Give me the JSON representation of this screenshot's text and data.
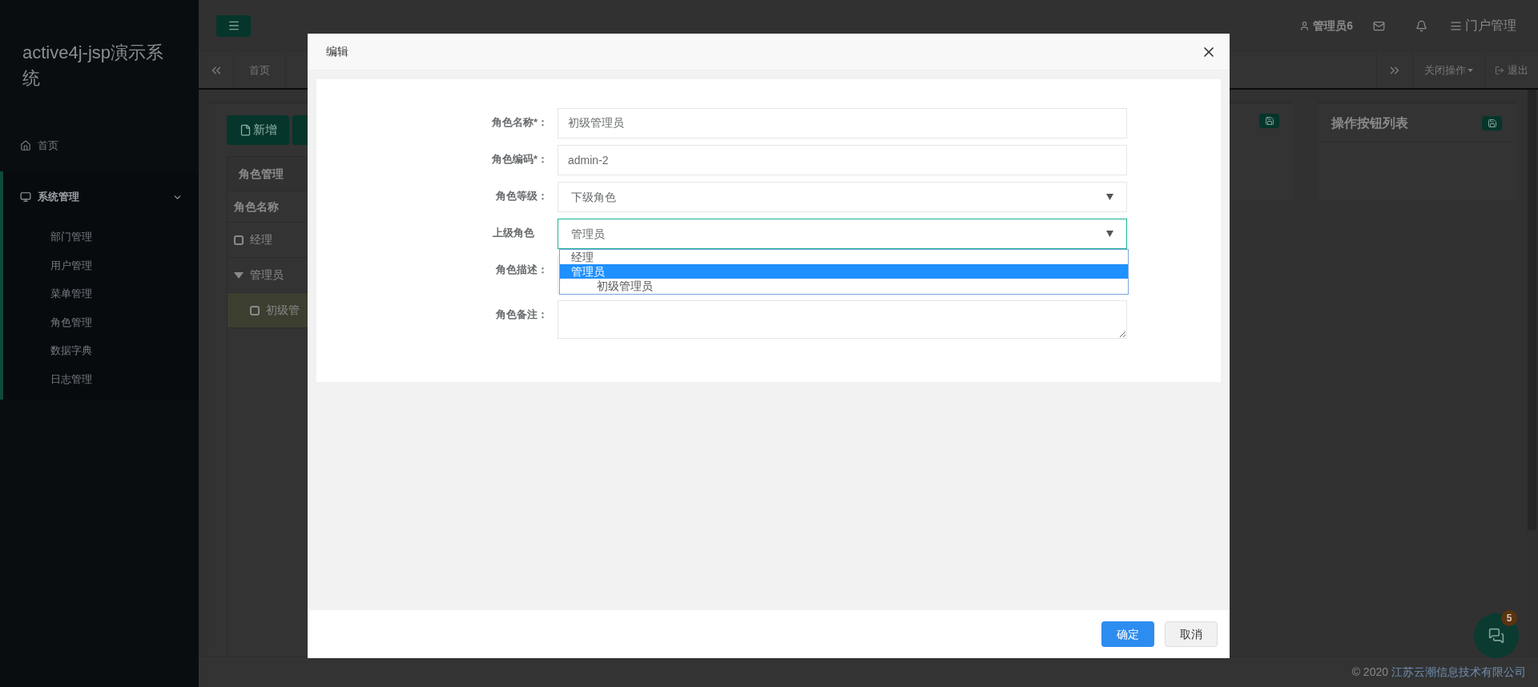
{
  "sidebar": {
    "title": "active4j-jsp演示系统",
    "items": [
      {
        "label": "首页",
        "kind": "home",
        "selected": false
      },
      {
        "label": "系统管理",
        "kind": "monitor",
        "selected": true,
        "expanded": true,
        "children": [
          {
            "label": "部门管理"
          },
          {
            "label": "用户管理"
          },
          {
            "label": "菜单管理"
          },
          {
            "label": "角色管理"
          },
          {
            "label": "数据字典"
          },
          {
            "label": "日志管理"
          }
        ]
      }
    ]
  },
  "header": {
    "user": "管理员6",
    "portal": "门户管理"
  },
  "tabs": {
    "items": [
      {
        "label": "首页"
      }
    ],
    "close_ops": "关闭操作",
    "logout": "退出"
  },
  "role_panel": {
    "buttons": [
      "新增"
    ],
    "title": "角色管理",
    "column": "角色名称",
    "tree": [
      {
        "label": "经理",
        "selected": false
      },
      {
        "label": "管理员",
        "selected": false,
        "expanded": true,
        "children": [
          {
            "label": "初级管",
            "selected": true
          }
        ]
      }
    ]
  },
  "button_panel": {
    "title": "操作按钮列表"
  },
  "chat": {
    "badge": "5"
  },
  "footer": {
    "copyright": "© 2020",
    "company": "江苏云潮信息技术有限公司"
  },
  "dialog": {
    "title": "编辑",
    "fields": [
      {
        "label": "角色名称*：",
        "kind": "input",
        "value": "初级管理员"
      },
      {
        "label": "角色编码*：",
        "kind": "input",
        "value": "admin-2"
      },
      {
        "label": "角色等级：",
        "kind": "select",
        "value": "下级角色",
        "focused": false
      },
      {
        "label": "上级角色",
        "kind": "select",
        "value": "管理员",
        "focused": true,
        "options": [
          {
            "label": "经理",
            "selected": false
          },
          {
            "label": "管理员",
            "selected": true,
            "children": [
              {
                "label": "初级管理员",
                "selected": false
              }
            ]
          }
        ]
      },
      {
        "label": "角色描述：",
        "kind": "textarea"
      },
      {
        "label": "角色备注：",
        "kind": "textarea"
      }
    ],
    "buttons": [
      {
        "label": "确定",
        "kind": "primary"
      },
      {
        "label": "取消",
        "kind": "default"
      }
    ]
  }
}
